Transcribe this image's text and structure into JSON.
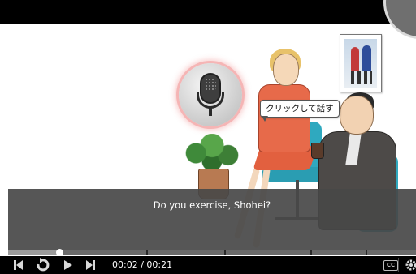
{
  "player": {
    "subtitle": "Do you exercise, Shohei?",
    "tooltip": "クリックして話す",
    "time_display": "00:02 / 00:21",
    "played_fraction": 0.125,
    "cc_label": "CC"
  },
  "icons": {
    "microphone": "microphone-icon",
    "previous": "skip-back-icon",
    "replay": "replay-icon",
    "play": "play-icon",
    "next": "skip-forward-icon",
    "captions": "closed-captions-icon",
    "settings": "gear-icon"
  },
  "colors": {
    "mic_glow": "#f5b5b5",
    "subtitle_bar": "#484848",
    "controls_bg": "#000000"
  }
}
